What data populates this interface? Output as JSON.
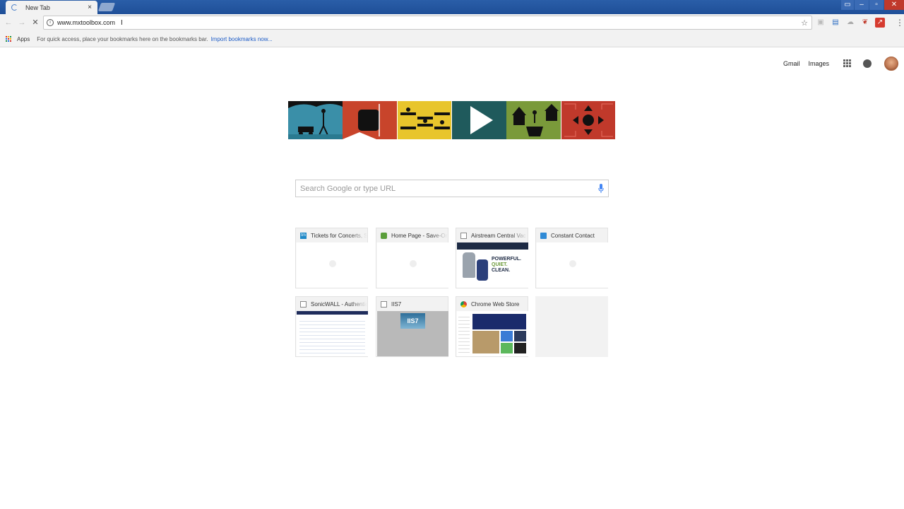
{
  "browser": {
    "tab_title": "New Tab",
    "tab_close": "×",
    "url": "www.mxtoolbox.com",
    "window_controls": [
      "minimize",
      "maximize",
      "close"
    ]
  },
  "bookmarks_bar": {
    "apps_label": "Apps",
    "hint": "For quick access, place your bookmarks here on the bookmarks bar.",
    "import_link": "Import bookmarks now..."
  },
  "google_bar": {
    "gmail": "Gmail",
    "images": "Images"
  },
  "search": {
    "placeholder": "Search Google or type URL"
  },
  "most_visited": [
    {
      "title": "Tickets for Concerts, Sports",
      "favicon": "tm-icon",
      "favicon_color": "#1e88c7"
    },
    {
      "title": "Home Page - Save-On-Foods",
      "favicon": "leaf-icon",
      "favicon_color": "#5a9e3a"
    },
    {
      "title": "Airstream Central Vac",
      "favicon": "page-icon",
      "favicon_color": "#888888"
    },
    {
      "title": "Constant Contact",
      "favicon": "chart-icon",
      "favicon_color": "#2f8ad6"
    },
    {
      "title": "SonicWALL - Authentication",
      "favicon": "page-icon",
      "favicon_color": "#888888"
    },
    {
      "title": "IIS7",
      "favicon": "page-icon",
      "favicon_color": "#888888"
    },
    {
      "title": "Chrome Web Store",
      "favicon": "chrome-icon",
      "favicon_color": "#db4437"
    }
  ],
  "thumb_text": {
    "airstream_line1": "POWERFUL.",
    "airstream_line2": "QUIET.",
    "airstream_line3": "CLEAN.",
    "iis": "IIS7"
  },
  "colors": {
    "titlebar": "#1f4f98",
    "link": "#1a5ac6",
    "doodle_panels": [
      "#3a8fa8",
      "#c8442b",
      "#e8c52c",
      "#1f5a5c",
      "#7a9a3a",
      "#c0392b"
    ]
  }
}
